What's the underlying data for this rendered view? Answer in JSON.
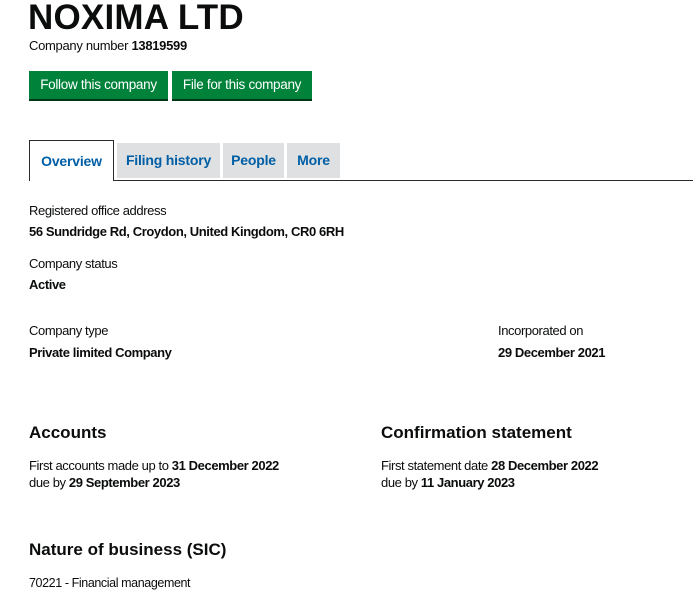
{
  "company": {
    "name": "NOXIMA LTD",
    "number_label": "Company number",
    "number": "13819599"
  },
  "actions": {
    "follow_label": "Follow this company",
    "file_label": "File for this company"
  },
  "tabs": [
    {
      "label": "Overview",
      "active": true
    },
    {
      "label": "Filing history",
      "active": false
    },
    {
      "label": "People",
      "active": false
    },
    {
      "label": "More",
      "active": false
    }
  ],
  "overview": {
    "registered_office": {
      "label": "Registered office address",
      "value": "56 Sundridge Rd, Croydon, United Kingdom, CR0 6RH"
    },
    "status": {
      "label": "Company status",
      "value": "Active"
    },
    "type": {
      "label": "Company type",
      "value": "Private limited Company"
    },
    "incorporated": {
      "label": "Incorporated on",
      "value": "29 December 2021"
    }
  },
  "accounts": {
    "heading": "Accounts",
    "line1_prefix": "First accounts made up to",
    "line1_date": "31 December 2022",
    "line2_prefix": "due by",
    "line2_date": "29 September 2023"
  },
  "confirmation": {
    "heading": "Confirmation statement",
    "line1_prefix": "First statement date",
    "line1_date": "28 December 2022",
    "line2_prefix": "due by",
    "line2_date": "11 January 2023"
  },
  "sic": {
    "heading": "Nature of business (SIC)",
    "items": [
      "70221 - Financial management"
    ]
  },
  "colors": {
    "button_green": "#00823b",
    "link_blue": "#005ea5",
    "tab_grey": "#dee0e2"
  }
}
